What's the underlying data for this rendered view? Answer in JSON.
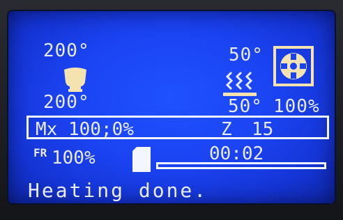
{
  "hotend": {
    "target": "200°",
    "current": "200°"
  },
  "bed": {
    "target": "50°",
    "current": "50°"
  },
  "fan": {
    "speed": "100%"
  },
  "position": {
    "mx_text": "Mx 100;0%",
    "z_label": "Z",
    "z_value": "15"
  },
  "feedrate": {
    "icon": "FR",
    "value": "100%"
  },
  "print": {
    "elapsed": "00:02",
    "progress": 0.0
  },
  "status": {
    "message": "Heating done."
  },
  "icons": {
    "hotend": "hotend-icon",
    "bed": "heated-bed-icon",
    "fan": "fan-icon",
    "sd": "sd-card-icon",
    "feedrate": "feedrate-icon"
  },
  "colors": {
    "screen": "#1b43f2",
    "text": "#e9ecff",
    "icon": "#f4e3b0"
  }
}
